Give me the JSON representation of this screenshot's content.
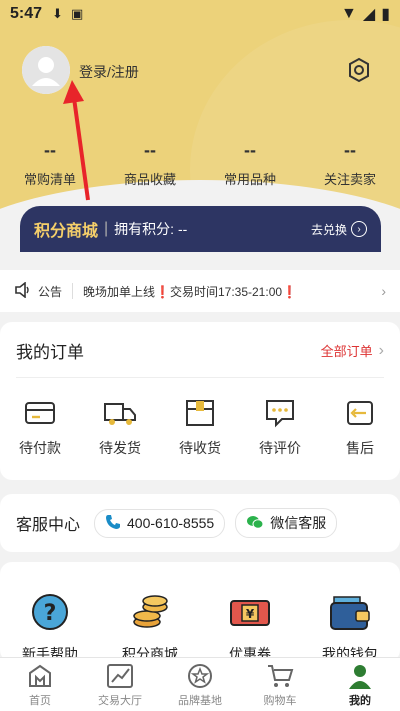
{
  "status_bar": {
    "time": "5:47"
  },
  "header": {
    "login_label": "登录/注册"
  },
  "stats": [
    {
      "value": "--",
      "label": "常购清单"
    },
    {
      "value": "--",
      "label": "商品收藏"
    },
    {
      "value": "--",
      "label": "常用品种"
    },
    {
      "value": "--",
      "label": "关注卖家"
    }
  ],
  "points": {
    "title": "积分商城",
    "separator": "|",
    "have_label": "拥有积分: --",
    "exchange_label": "去兑换"
  },
  "notice": {
    "label": "公告",
    "message_prefix": "晚场加单上线",
    "message_suffix": "交易时间17:35-21:00",
    "warn_mark": "❗"
  },
  "orders": {
    "title": "我的订单",
    "all_label": "全部订单",
    "items": [
      {
        "label": "待付款",
        "icon": "wallet-icon"
      },
      {
        "label": "待发货",
        "icon": "truck-icon"
      },
      {
        "label": "待收货",
        "icon": "package-icon"
      },
      {
        "label": "待评价",
        "icon": "comment-icon"
      },
      {
        "label": "售后",
        "icon": "return-icon"
      }
    ]
  },
  "service": {
    "title": "客服中心",
    "phone": "400-610-8555",
    "wechat": "微信客服"
  },
  "tools": [
    {
      "label": "新手帮助",
      "icon": "help-icon"
    },
    {
      "label": "积分商城",
      "icon": "coins-icon"
    },
    {
      "label": "优惠券",
      "icon": "coupon-icon"
    },
    {
      "label": "我的钱包",
      "icon": "wallet-icon"
    }
  ],
  "tabs": [
    {
      "label": "首页",
      "icon": "home-icon"
    },
    {
      "label": "交易大厅",
      "icon": "trade-icon"
    },
    {
      "label": "品牌基地",
      "icon": "brand-icon"
    },
    {
      "label": "购物车",
      "icon": "cart-icon"
    },
    {
      "label": "我的",
      "icon": "user-icon",
      "active": true
    }
  ],
  "colors": {
    "hero": "#ecd27a",
    "points_bg": "#2d3563",
    "accent_red": "#d33",
    "active_tab": "#2e7d32"
  }
}
